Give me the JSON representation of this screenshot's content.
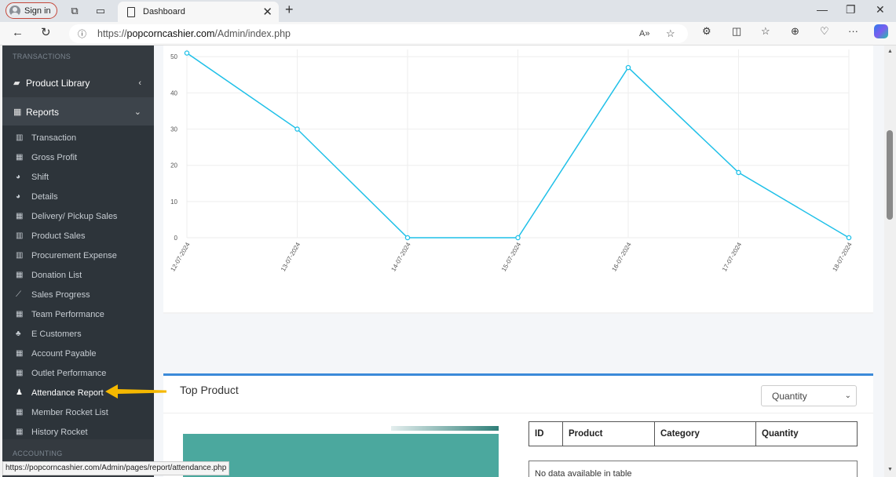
{
  "browser": {
    "signin_label": "Sign in",
    "tab_title": "Dashboard",
    "url_prefix": "https://",
    "url_domain": "popcorncashier.com",
    "url_path": "/Admin/index.php",
    "status_url": "https://popcorncashier.com/Admin/pages/report/attendance.php"
  },
  "sidebar": {
    "top_section": "TRANSACTIONS",
    "product_library": "Product Library",
    "reports": "Reports",
    "items": [
      {
        "label": "Transaction",
        "icon": "bar-chart-icon"
      },
      {
        "label": "Gross Profit",
        "icon": "table-icon"
      },
      {
        "label": "Shift",
        "icon": "pie-chart-icon"
      },
      {
        "label": "Details",
        "icon": "pie-chart-icon"
      },
      {
        "label": "Delivery/ Pickup Sales",
        "icon": "table-icon"
      },
      {
        "label": "Product Sales",
        "icon": "bar-chart-icon"
      },
      {
        "label": "Procurement Expense",
        "icon": "bar-chart-icon"
      },
      {
        "label": "Donation List",
        "icon": "table-icon"
      },
      {
        "label": "Sales Progress",
        "icon": "line-chart-icon"
      },
      {
        "label": "Team Performance",
        "icon": "table-icon"
      },
      {
        "label": "E Customers",
        "icon": "users-icon"
      },
      {
        "label": "Account Payable",
        "icon": "table-icon"
      },
      {
        "label": "Outlet Performance",
        "icon": "table-icon"
      },
      {
        "label": "Attendance Report",
        "icon": "person-icon"
      },
      {
        "label": "Member Rocket List",
        "icon": "table-icon"
      },
      {
        "label": "History Rocket",
        "icon": "table-icon"
      }
    ],
    "bottom_section": "ACCOUNTING"
  },
  "chart_data": {
    "type": "line",
    "x": [
      "12-07-2024",
      "13-07-2024",
      "14-07-2024",
      "15-07-2024",
      "16-07-2024",
      "17-07-2024",
      "18-07-2024"
    ],
    "values": [
      51,
      30,
      0,
      0,
      47,
      18,
      0
    ],
    "y_ticks": [
      0,
      10,
      20,
      30,
      40,
      50
    ],
    "ylim": [
      0,
      52
    ],
    "color": "#1fc0e8",
    "grid": true
  },
  "top_product": {
    "title": "Top Product",
    "select_value": "Quantity",
    "columns": [
      "ID",
      "Product",
      "Category",
      "Quantity"
    ],
    "empty_text": "No data available in table"
  },
  "colors": {
    "sidebar_bg": "#343a40",
    "accent": "#3b8ad9",
    "annotation_arrow": "#f5b800"
  }
}
